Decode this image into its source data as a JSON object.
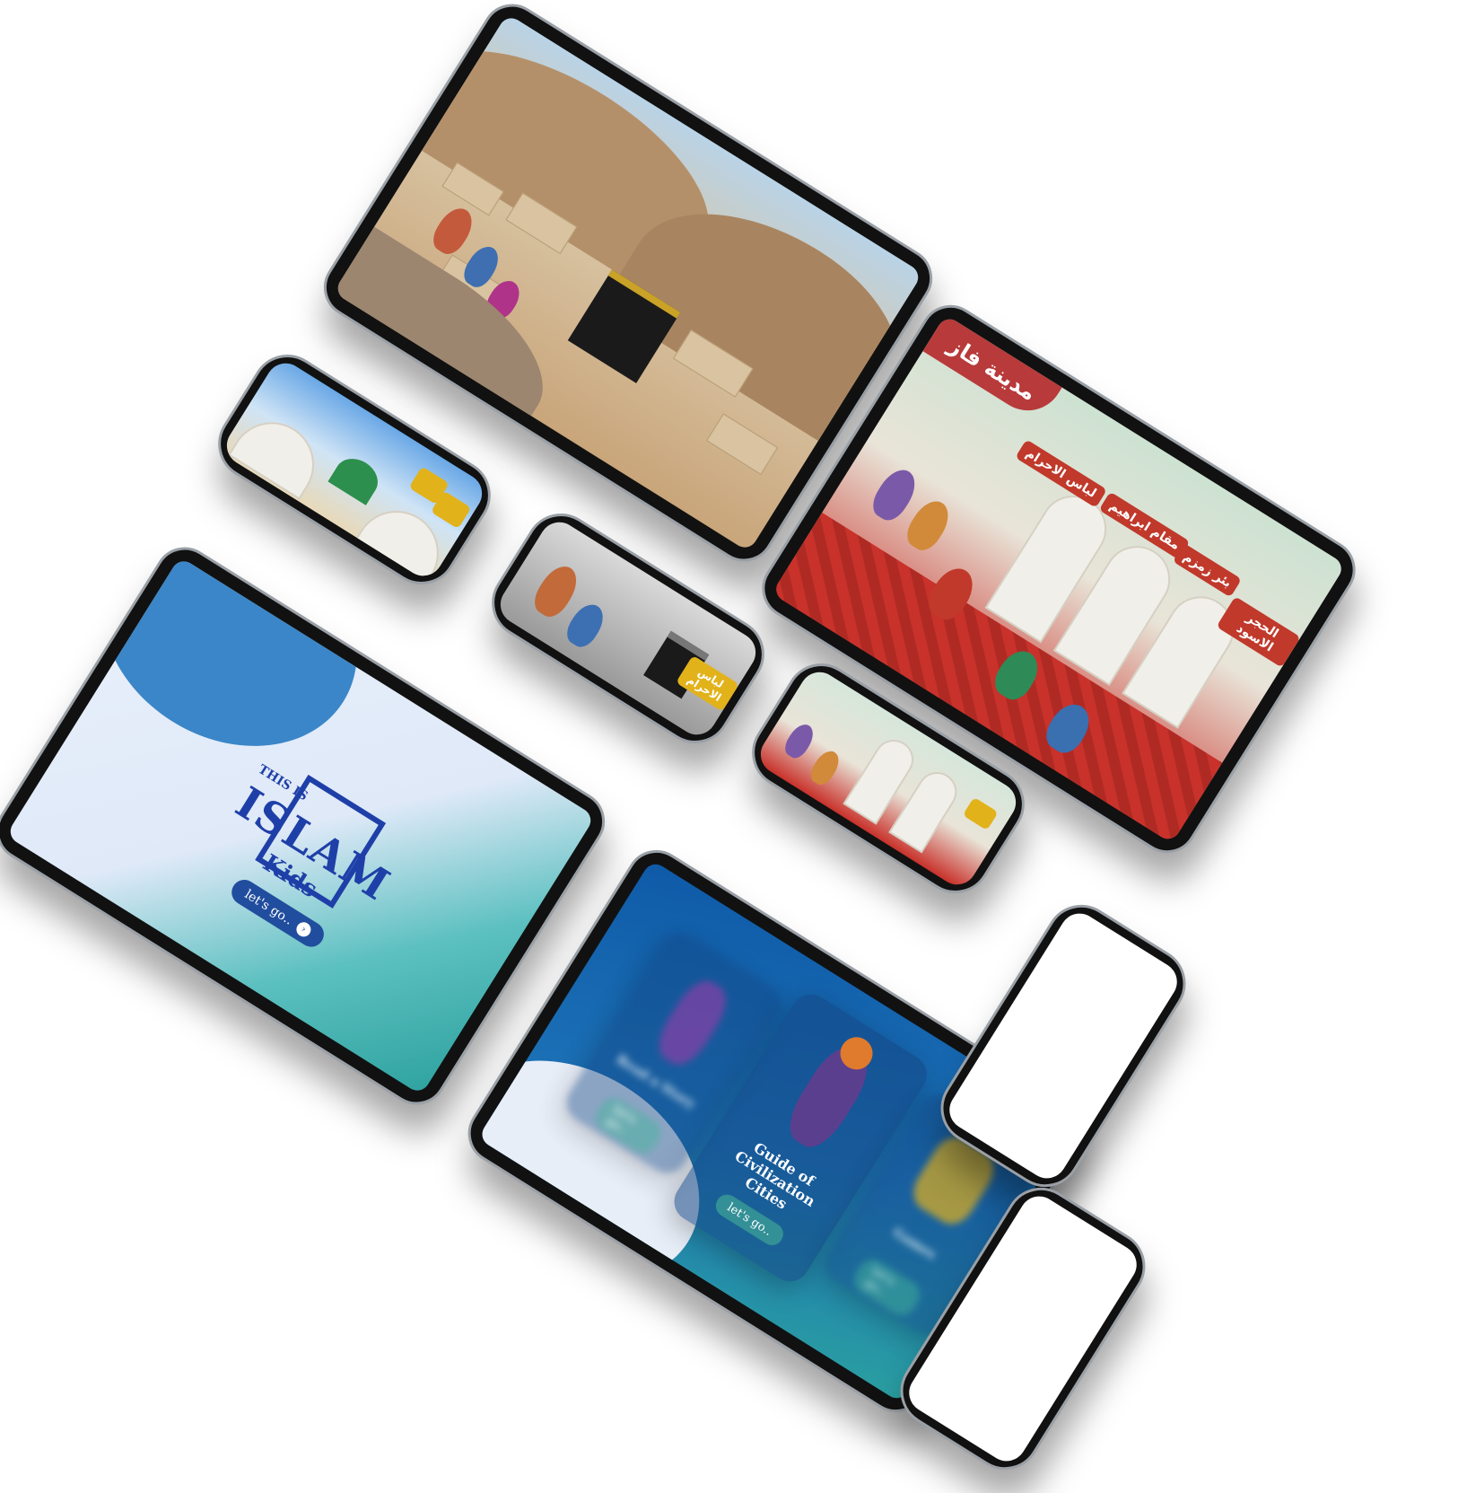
{
  "devices": {
    "tablet_kids": {
      "logo_small": "THIS IS",
      "logo_main": "ISLAM",
      "logo_sub": "Kids",
      "button_label": "let's go..",
      "colors": {
        "bg_from": "#e9f0fb",
        "bg_to": "#2fa3a0",
        "brand": "#1f3fa8"
      }
    },
    "tablet_fez": {
      "city_title": "مدينة فاز",
      "hotspots": [
        "لباس الاحرام",
        "مقام ابراهيم",
        "بئر زمزم",
        "الحجر الاسود"
      ],
      "colors": {
        "banner": "#b83a3a",
        "hotspot": "#c0392b"
      }
    },
    "phone_mono": {
      "hotspot": "لباس الاحرام",
      "colors": {
        "hotspot": "#e2b21b"
      }
    },
    "tablet_menu": {
      "cards": [
        {
          "title": "Read a Story",
          "button": "let's go.."
        },
        {
          "title": "Guide of Civilization Cities",
          "button": "let's go.."
        },
        {
          "title": "Games",
          "button": "let's go.."
        }
      ],
      "colors": {
        "bg_from": "#0f5aa8",
        "bg_to": "#2a9fa0"
      }
    }
  }
}
